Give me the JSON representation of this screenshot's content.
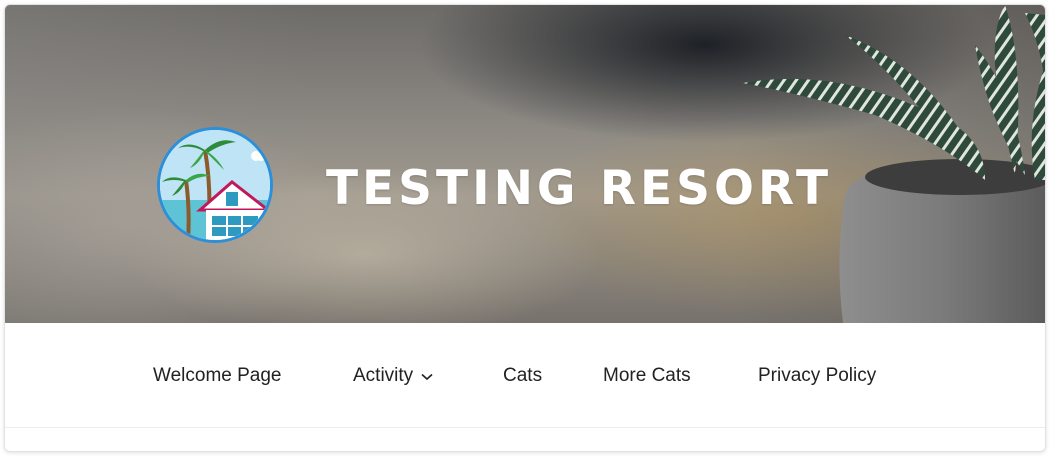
{
  "site": {
    "title": "TESTING RESORT",
    "logo_icon": "resort-logo-icon"
  },
  "nav": {
    "items": [
      {
        "label": "Welcome Page"
      },
      {
        "label": "Activity",
        "has_submenu": true,
        "icon": "chevron-down-icon"
      },
      {
        "label": "Cats"
      },
      {
        "label": "More Cats"
      },
      {
        "label": "Privacy Policy"
      }
    ]
  },
  "colors": {
    "logo_border": "#2c8fd9",
    "title_text": "#ffffff",
    "nav_text": "#222222"
  }
}
